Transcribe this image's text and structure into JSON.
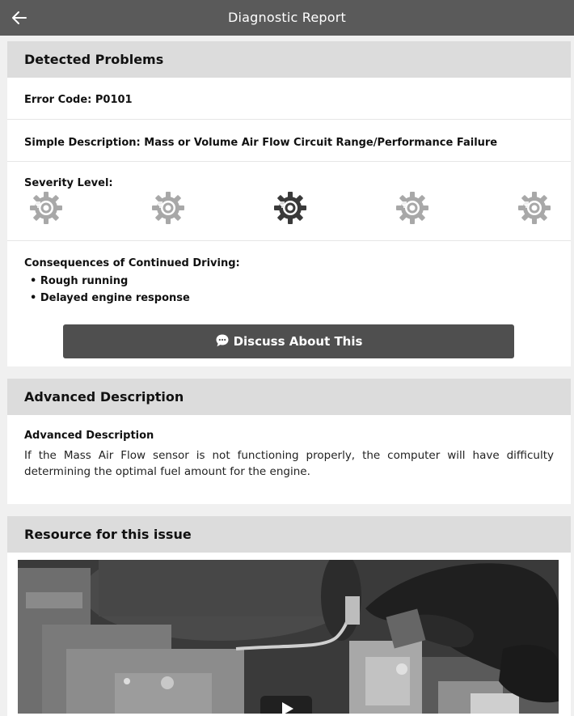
{
  "header": {
    "title": "Diagnostic Report",
    "back_icon": "arrow-left-icon"
  },
  "detected": {
    "title": "Detected Problems",
    "error_code": "Error Code: P0101",
    "simple_description": "Simple Description: Mass or Volume Air Flow Circuit Range/Performance Failure",
    "severity_label": "Severity Level:",
    "severity_level": 3,
    "severity_max": 5,
    "consequences_label": "Consequences of Continued Driving:",
    "consequences": [
      "Rough running",
      "Delayed engine response"
    ],
    "discuss_button": "Discuss About This",
    "discuss_icon": "chat-bubble-icon"
  },
  "advanced": {
    "title": "Advanced Description",
    "subtitle": "Advanced Description",
    "text": "If the Mass Air Flow sensor is not functioning properly, the computer will have difficulty determining the optimal fuel amount for the engine."
  },
  "resource": {
    "title": "Resource for this issue",
    "video_thumbnail": "engine-bay-repair-thumbnail",
    "play_icon": "play-icon"
  },
  "colors": {
    "header_bg": "#5a5a5a",
    "section_header_bg": "#dcdcdc",
    "button_bg": "#4f4f4f",
    "gear_active": "#3a3a3a",
    "gear_inactive": "#a8a8a8"
  }
}
